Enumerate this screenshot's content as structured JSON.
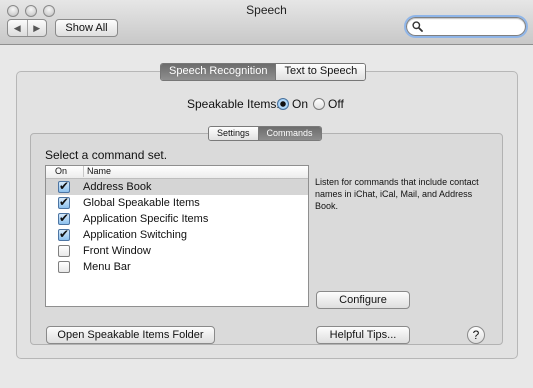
{
  "window": {
    "title": "Speech"
  },
  "toolbar": {
    "show_all_label": "Show All",
    "back_icon": "◀",
    "forward_icon": "▶",
    "search_value": "",
    "search_placeholder": ""
  },
  "tabs": [
    {
      "label": "Speech Recognition",
      "active": true
    },
    {
      "label": "Text to Speech",
      "active": false
    }
  ],
  "speakable_items": {
    "label": "Speakable Items:",
    "on_label": "On",
    "off_label": "Off",
    "selected": "On"
  },
  "subtabs": [
    {
      "label": "Settings",
      "active": false
    },
    {
      "label": "Commands",
      "active": true
    }
  ],
  "command_set": {
    "prompt": "Select a command set.",
    "columns": {
      "on": "On",
      "name": "Name"
    },
    "items": [
      {
        "name": "Address Book",
        "checked": true,
        "selected": true
      },
      {
        "name": "Global Speakable Items",
        "checked": true,
        "selected": false
      },
      {
        "name": "Application Specific Items",
        "checked": true,
        "selected": false
      },
      {
        "name": "Application Switching",
        "checked": true,
        "selected": false
      },
      {
        "name": "Front Window",
        "checked": false,
        "selected": false
      },
      {
        "name": "Menu Bar",
        "checked": false,
        "selected": false
      }
    ],
    "description": "Listen for commands that include contact names in iChat, iCal, Mail, and Address Book."
  },
  "buttons": {
    "configure": "Configure",
    "open_folder": "Open Speakable Items Folder",
    "helpful_tips": "Helpful Tips...",
    "help": "?"
  }
}
